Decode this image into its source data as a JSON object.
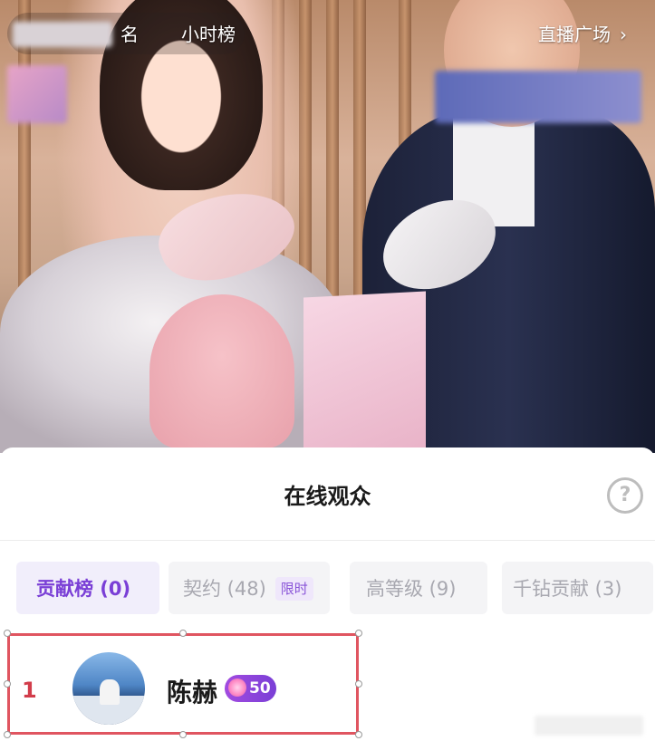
{
  "video": {
    "rank_suffix": "名",
    "hourly_rank_label": "小时榜",
    "plaza_link_label": "直播广场",
    "plaza_chevron_icon": "chevron-right-icon"
  },
  "sheet": {
    "title": "在线观众",
    "help_icon": "question-circle-icon",
    "help_glyph": "?",
    "tabs": [
      {
        "label": "贡献榜 (0)",
        "active": true
      },
      {
        "label": "契约 (48)",
        "tag": "限时",
        "active": false
      },
      {
        "label": "高等级 (9)",
        "active": false
      },
      {
        "label": "千钻贡献 (3)",
        "active": false
      }
    ],
    "viewers": [
      {
        "rank": "1",
        "name": "陈赫",
        "level": "50",
        "level_icon": "gem-icon"
      }
    ]
  },
  "colors": {
    "accent": "#7a3fd6",
    "rank_red": "#d23c4a",
    "highlight_border": "#e05560"
  }
}
